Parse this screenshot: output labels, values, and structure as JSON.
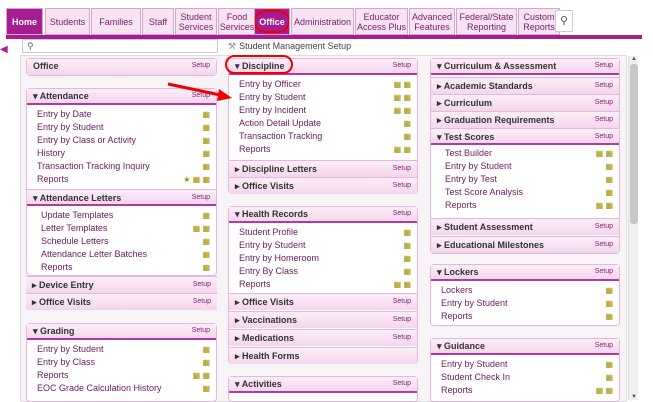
{
  "tabs": [
    "Home",
    "Students",
    "Families",
    "Staff",
    "Student Services",
    "Food Services",
    "Office",
    "Administration",
    "Educator Access Plus",
    "Advanced Features",
    "Federal/State Reporting",
    "Custom Reports"
  ],
  "search_placeholder": "",
  "breadcrumb": "Student Management Setup",
  "setup": "Setup",
  "col1": {
    "office": "Office",
    "attendance": {
      "title": "Attendance",
      "items": [
        "Entry by Date",
        "Entry by Student",
        "Entry by Class or Activity",
        "History",
        "Transaction Tracking Inquiry",
        "Reports"
      ]
    },
    "attendance_letters": {
      "title": "Attendance Letters",
      "items": [
        "Update Templates",
        "Letter Templates",
        "Schedule Letters",
        "Attendance Letter Batches",
        "Reports"
      ]
    },
    "device_entry": "Device Entry",
    "office_visits": "Office Visits",
    "grading": {
      "title": "Grading",
      "items": [
        "Entry by Student",
        "Entry by Class",
        "Reports",
        "EOC Grade Calculation History"
      ]
    }
  },
  "col2": {
    "discipline": {
      "title": "Discipline",
      "items": [
        "Entry by Officer",
        "Entry by Student",
        "Entry by Incident",
        "Action Detail Update",
        "Transaction Tracking",
        "Reports"
      ]
    },
    "discipline_letters": "Discipline Letters",
    "office_visits": "Office Visits",
    "health": {
      "title": "Health Records",
      "items": [
        "Student Profile",
        "Entry by Student",
        "Entry by Homeroom",
        "Entry By Class",
        "Reports"
      ]
    },
    "health_subs": [
      "Office Visits",
      "Vaccinations",
      "Medications",
      "Health Forms"
    ],
    "activities": "Activities"
  },
  "col3": {
    "curriculum": "Curriculum & Assessment",
    "subs": [
      "Academic Standards",
      "Curriculum",
      "Graduation Requirements"
    ],
    "test_scores": {
      "title": "Test Scores",
      "items": [
        "Test Builder",
        "Entry by Student",
        "Entry by Test",
        "Test Score Analysis",
        "Reports"
      ]
    },
    "subs2": [
      "Student Assessment",
      "Educational Milestones"
    ],
    "lockers": {
      "title": "Lockers",
      "items": [
        "Lockers",
        "Entry by Student",
        "Reports"
      ]
    },
    "guidance": {
      "title": "Guidance",
      "items": [
        "Entry by Student",
        "Student Check In",
        "Reports"
      ]
    }
  }
}
